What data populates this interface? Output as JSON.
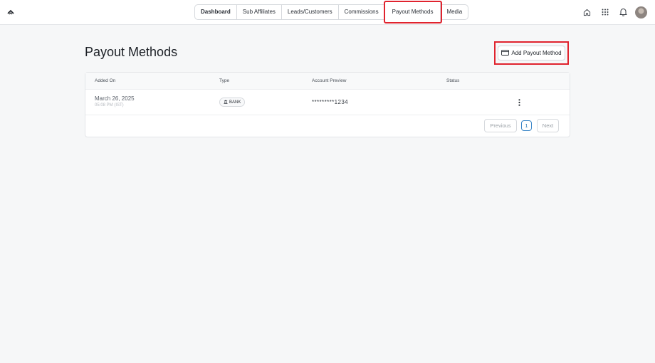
{
  "nav": {
    "items": [
      {
        "label": "Dashboard"
      },
      {
        "label": "Sub Affiliates"
      },
      {
        "label": "Leads/Customers"
      },
      {
        "label": "Commissions"
      },
      {
        "label": "Payout Methods"
      },
      {
        "label": "Media"
      }
    ]
  },
  "header": {
    "icons": [
      "home-icon",
      "grid-icon",
      "bell-icon"
    ]
  },
  "page": {
    "title": "Payout Methods",
    "add_button_label": "Add Payout Method",
    "add_button_icon": "card-icon"
  },
  "table": {
    "columns": [
      "Added On",
      "Type",
      "Account Preview",
      "Status"
    ],
    "rows": [
      {
        "date": "March 26, 2025",
        "time": "05:08 PM (IST)",
        "type": "BANK",
        "type_icon": "bank-icon",
        "account": "*********1234",
        "status": ""
      }
    ]
  },
  "pagination": {
    "previous": "Previous",
    "page": "1",
    "next": "Next"
  },
  "colors": {
    "highlight": "#e0232e",
    "accent": "#2c7bb6",
    "background": "#f6f7f8"
  }
}
